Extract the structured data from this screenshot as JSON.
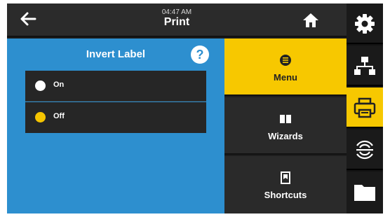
{
  "header": {
    "time": "04:47 AM",
    "title": "Print"
  },
  "icons": {
    "back": "back-arrow-icon",
    "home": "home-icon",
    "help": "help-icon"
  },
  "panel": {
    "title": "Invert Label",
    "help_glyph": "?",
    "options": [
      {
        "label": "On",
        "selected": false
      },
      {
        "label": "Off",
        "selected": true
      }
    ]
  },
  "menu": {
    "items": [
      {
        "label": "Menu",
        "icon": "menu-icon",
        "active": true
      },
      {
        "label": "Wizards",
        "icon": "book-icon",
        "active": false
      },
      {
        "label": "Shortcuts",
        "icon": "bookmark-icon",
        "active": false
      }
    ]
  },
  "sidebar": {
    "items": [
      {
        "icon": "gear-icon",
        "active": false
      },
      {
        "icon": "network-icon",
        "active": false
      },
      {
        "icon": "printer-icon",
        "active": true
      },
      {
        "icon": "rfid-icon",
        "active": false
      },
      {
        "icon": "folder-icon",
        "active": false
      }
    ]
  },
  "colors": {
    "accent": "#f7c800",
    "panel": "#2d8fcf",
    "background": "#1a1a1a"
  }
}
